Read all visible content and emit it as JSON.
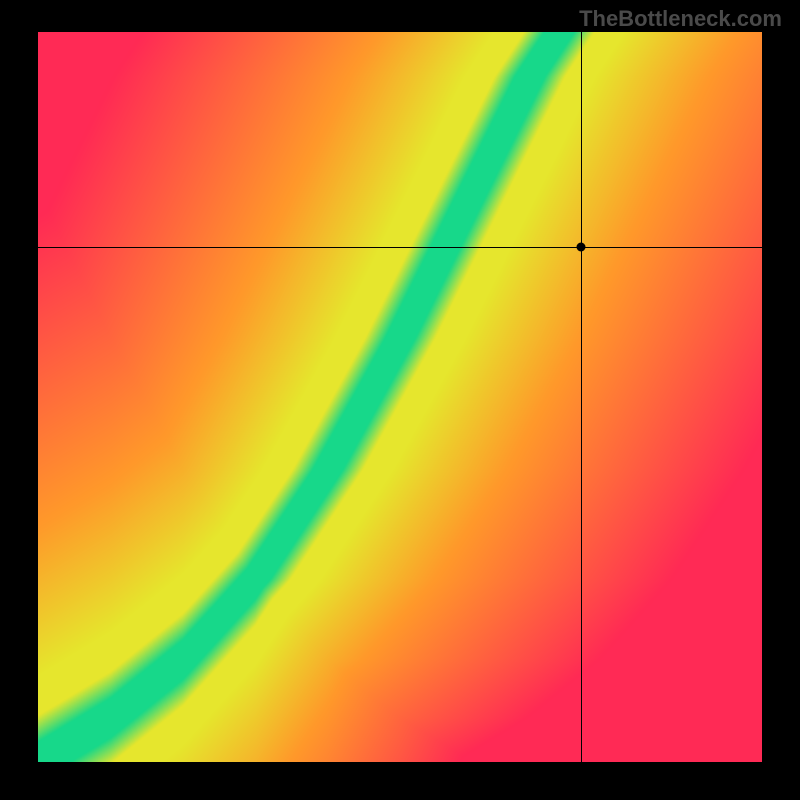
{
  "watermark": "TheBottleneck.com",
  "chart_data": {
    "type": "heatmap",
    "title": "",
    "xlabel": "",
    "ylabel": "",
    "xlim": [
      0,
      1
    ],
    "ylim": [
      0,
      1
    ],
    "marker": {
      "x": 0.75,
      "y": 0.705
    },
    "optimal_curve_description": "S-shaped green band from bottom-left corner to top edge near x≈0.7; red towards edges away from band; yellow-orange transition zone.",
    "optimal_curve_points": [
      {
        "x": 0.0,
        "y": 0.0
      },
      {
        "x": 0.1,
        "y": 0.06
      },
      {
        "x": 0.2,
        "y": 0.14
      },
      {
        "x": 0.3,
        "y": 0.25
      },
      {
        "x": 0.4,
        "y": 0.4
      },
      {
        "x": 0.5,
        "y": 0.58
      },
      {
        "x": 0.56,
        "y": 0.7
      },
      {
        "x": 0.62,
        "y": 0.82
      },
      {
        "x": 0.68,
        "y": 0.94
      },
      {
        "x": 0.72,
        "y": 1.0
      }
    ],
    "band_halfwidth": 0.045,
    "colors": {
      "optimal": "#17d88a",
      "near": "#e6e62d",
      "mid": "#ff9a2a",
      "far": "#ff2a55"
    }
  }
}
